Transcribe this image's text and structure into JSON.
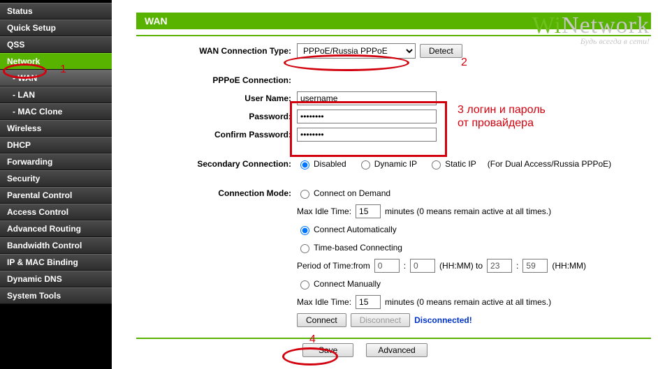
{
  "sidebar": {
    "items": [
      {
        "label": "Status"
      },
      {
        "label": "Quick Setup"
      },
      {
        "label": "QSS"
      },
      {
        "label": "Network",
        "active": true
      },
      {
        "label": "- WAN",
        "sub": true,
        "selected": true
      },
      {
        "label": "- LAN",
        "sub": true
      },
      {
        "label": "- MAC Clone",
        "sub": true
      },
      {
        "label": "Wireless"
      },
      {
        "label": "DHCP"
      },
      {
        "label": "Forwarding"
      },
      {
        "label": "Security"
      },
      {
        "label": "Parental Control"
      },
      {
        "label": "Access Control"
      },
      {
        "label": "Advanced Routing"
      },
      {
        "label": "Bandwidth Control"
      },
      {
        "label": "IP & MAC Binding"
      },
      {
        "label": "Dynamic DNS"
      },
      {
        "label": "System Tools"
      }
    ]
  },
  "page": {
    "title": "WAN"
  },
  "labels": {
    "conn_type": "WAN Connection Type:",
    "pppoe_sect": "PPPoE Connection:",
    "username": "User Name:",
    "password": "Password:",
    "confirm": "Confirm Password:",
    "secondary": "Secondary Connection:",
    "mode": "Connection Mode:",
    "max_idle": "Max Idle Time:",
    "period_prefix": "Period of Time:from",
    "period_to": "(HH:MM) to",
    "period_suffix": "(HH:MM)",
    "idle_note": "minutes (0 means remain active at all times.)",
    "for_dual": "(For Dual Access/Russia PPPoE)"
  },
  "wan": {
    "type_selected": "PPPoE/Russia PPPoE",
    "username": "username",
    "password": "••••••••",
    "confirm": "••••••••",
    "secondary": {
      "disabled": "Disabled",
      "dynamic": "Dynamic IP",
      "static": "Static IP",
      "selected": "disabled"
    },
    "mode": {
      "on_demand": "Connect on Demand",
      "auto": "Connect Automatically",
      "time": "Time-based Connecting",
      "manual": "Connect Manually",
      "selected": "auto",
      "idle1": "15",
      "idle2": "15",
      "t_from_h": "0",
      "t_from_m": "0",
      "t_to_h": "23",
      "t_to_m": "59"
    },
    "status": "Disconnected!"
  },
  "buttons": {
    "detect": "Detect",
    "connect": "Connect",
    "disconnect": "Disconnect",
    "save": "Save",
    "advanced": "Advanced"
  },
  "annotations": {
    "n1": "1",
    "n2": "2",
    "n3": "3 логин и пароль от провайдера",
    "n4": "4"
  },
  "watermark": {
    "brand_prefix": "Wi",
    "brand_rest": "Network",
    "slogan": "Будь всегда в сети!"
  }
}
